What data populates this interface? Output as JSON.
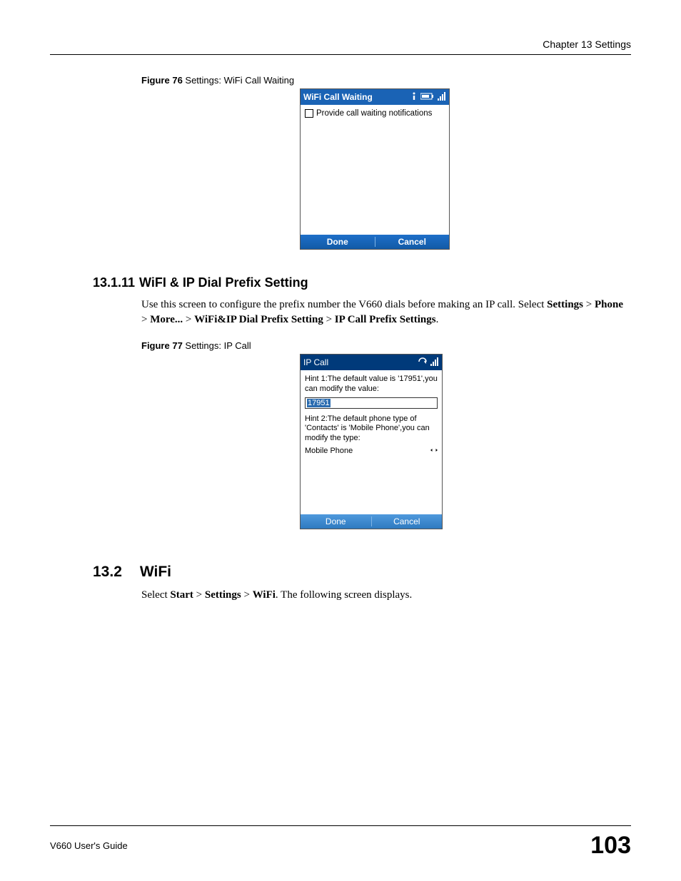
{
  "header": {
    "chapter": "Chapter 13 Settings"
  },
  "figure76": {
    "label_bold": "Figure 76",
    "label_rest": "   Settings: WiFi Call Waiting",
    "title": "WiFi Call Waiting",
    "checkbox_label": "Provide call waiting notifications",
    "done": "Done",
    "cancel": "Cancel"
  },
  "section_13_1_11": {
    "number": "13.1.11",
    "title": "WiFI & IP Dial Prefix Setting",
    "intro": "Use this screen to configure the prefix number the V660 dials before making an IP call. Select ",
    "path": [
      "Settings",
      "Phone",
      "More...",
      "WiFi&IP Dial Prefix Setting",
      "IP Call Prefix Settings"
    ]
  },
  "figure77": {
    "label_bold": "Figure 77",
    "label_rest": "   Settings: IP Call",
    "title": "IP Call",
    "hint1": "Hint 1:The default value is '17951',you can modify the value:",
    "input_value": "17951",
    "hint2": "Hint 2:The default phone type of 'Contacts' is 'Mobile Phone',you can modify the type:",
    "selector_value": "Mobile Phone",
    "done": "Done",
    "cancel": "Cancel"
  },
  "section_13_2": {
    "number": "13.2",
    "title": "WiFi",
    "intro_pre": "Select ",
    "path": [
      "Start",
      "Settings",
      "WiFi"
    ],
    "intro_post": ". The following screen displays."
  },
  "footer": {
    "guide": "V660 User's Guide",
    "page": "103"
  }
}
